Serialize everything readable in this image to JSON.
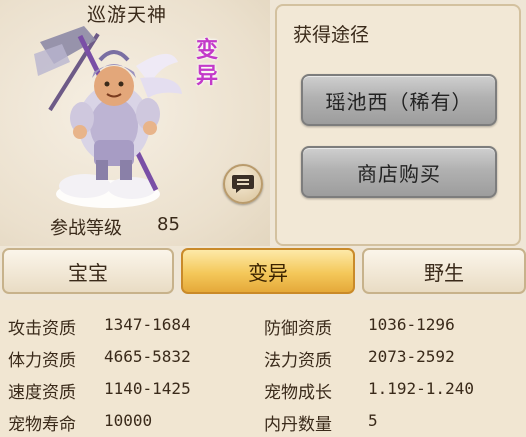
{
  "pet": {
    "name": "巡游天神",
    "badge": "变\n异",
    "badge_color": "#c33ac9",
    "level_label": "参战等级",
    "level_value": "85"
  },
  "chat_button": {
    "icon": "chat-bubble-icon"
  },
  "acquire": {
    "title": "获得途径",
    "buttons": [
      "瑶池西（稀有）",
      "商店购买"
    ]
  },
  "tabs": {
    "items": [
      "宝宝",
      "变异",
      "野生"
    ],
    "selected": 1
  },
  "stats": {
    "left": [
      {
        "label": "攻击资质",
        "value": "1347-1684"
      },
      {
        "label": "体力资质",
        "value": "4665-5832"
      },
      {
        "label": "速度资质",
        "value": "1140-1425"
      },
      {
        "label": "宠物寿命",
        "value": "10000"
      }
    ],
    "right": [
      {
        "label": "防御资质",
        "value": "1036-1296"
      },
      {
        "label": "法力资质",
        "value": "2073-2592"
      },
      {
        "label": "宠物成长",
        "value": "1.192-1.240"
      },
      {
        "label": "内丹数量",
        "value": "5"
      }
    ]
  }
}
